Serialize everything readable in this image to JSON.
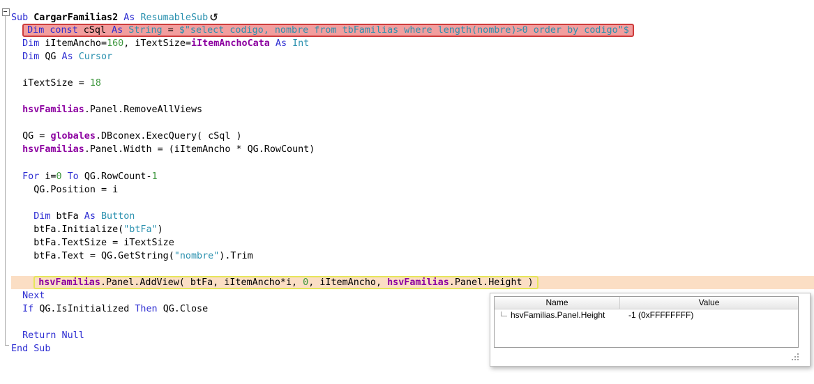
{
  "editor": {
    "colors": {
      "keyword": "#2d2dd2",
      "type": "#2b91af",
      "string": "#2b91af",
      "number": "#3c963c",
      "global_variable": "#8c00a0",
      "plain": "#000000",
      "error_highlight_bg": "#f29e9e",
      "error_highlight_border": "#ce3c3c",
      "current_line_bg": "#fbdec4",
      "current_statement_border": "#e6e65a",
      "fold_guide": "#ababab"
    },
    "icons": {
      "resumable_sub": "↺",
      "fold_collapse": "minus-box",
      "tree_branch": "corner-line",
      "resize_grip": "dot-triangle"
    },
    "lines": [
      {
        "i": 0,
        "h": null,
        "t": [
          [
            "k",
            "Sub "
          ],
          [
            "b",
            "CargarFamilias2"
          ],
          [
            "k",
            " As "
          ],
          [
            "t",
            "ResumableSub"
          ],
          [
            "ic",
            "↺"
          ]
        ]
      },
      {
        "i": 1,
        "h": "error",
        "t": [
          [
            "k",
            "Dim const "
          ],
          [
            "p",
            "cSql"
          ],
          [
            "k",
            " As "
          ],
          [
            "t",
            "String"
          ],
          [
            "p",
            " = "
          ],
          [
            "s",
            "$\"select codigo, nombre from tbFamilias where length(nombre)>0 order by codigo\"$"
          ]
        ]
      },
      {
        "i": 1,
        "h": null,
        "t": [
          [
            "k",
            "Dim "
          ],
          [
            "p",
            "iItemAncho="
          ],
          [
            "n",
            "160"
          ],
          [
            "p",
            ", iTextSize="
          ],
          [
            "g",
            "iItemAnchoCata"
          ],
          [
            "k",
            " As "
          ],
          [
            "t",
            "Int"
          ]
        ]
      },
      {
        "i": 1,
        "h": null,
        "t": [
          [
            "k",
            "Dim "
          ],
          [
            "p",
            "QG"
          ],
          [
            "k",
            " As "
          ],
          [
            "t",
            "Cursor"
          ]
        ]
      },
      {
        "i": 1,
        "h": null,
        "t": []
      },
      {
        "i": 1,
        "h": null,
        "t": [
          [
            "p",
            "iTextSize = "
          ],
          [
            "n",
            "18"
          ]
        ]
      },
      {
        "i": 1,
        "h": null,
        "t": []
      },
      {
        "i": 1,
        "h": null,
        "t": [
          [
            "g",
            "hsvFamilias"
          ],
          [
            "p",
            ".Panel.RemoveAllViews"
          ]
        ]
      },
      {
        "i": 1,
        "h": null,
        "t": []
      },
      {
        "i": 1,
        "h": null,
        "t": [
          [
            "p",
            "QG = "
          ],
          [
            "g",
            "globales"
          ],
          [
            "p",
            ".DBconex.ExecQuery( cSql )"
          ]
        ]
      },
      {
        "i": 1,
        "h": null,
        "t": [
          [
            "g",
            "hsvFamilias"
          ],
          [
            "p",
            ".Panel.Width = (iItemAncho * QG.RowCount)"
          ]
        ]
      },
      {
        "i": 1,
        "h": null,
        "t": []
      },
      {
        "i": 1,
        "h": null,
        "t": [
          [
            "k",
            "For "
          ],
          [
            "p",
            "i="
          ],
          [
            "n",
            "0"
          ],
          [
            "k",
            " To "
          ],
          [
            "p",
            "QG.RowCount-"
          ],
          [
            "n",
            "1"
          ]
        ]
      },
      {
        "i": 2,
        "h": null,
        "t": [
          [
            "p",
            "QG.Position = i"
          ]
        ]
      },
      {
        "i": 2,
        "h": null,
        "t": []
      },
      {
        "i": 2,
        "h": null,
        "t": [
          [
            "k",
            "Dim "
          ],
          [
            "p",
            "btFa"
          ],
          [
            "k",
            " As "
          ],
          [
            "t",
            "Button"
          ]
        ]
      },
      {
        "i": 2,
        "h": null,
        "t": [
          [
            "p",
            "btFa.Initialize("
          ],
          [
            "s",
            "\"btFa\""
          ],
          [
            "p",
            ")"
          ]
        ]
      },
      {
        "i": 2,
        "h": null,
        "t": [
          [
            "p",
            "btFa.TextSize = iTextSize"
          ]
        ]
      },
      {
        "i": 2,
        "h": null,
        "t": [
          [
            "p",
            "btFa.Text = QG.GetString("
          ],
          [
            "s",
            "\"nombre\""
          ],
          [
            "p",
            ").Trim"
          ]
        ]
      },
      {
        "i": 2,
        "h": null,
        "t": []
      },
      {
        "i": 2,
        "h": "current",
        "t": [
          [
            "g",
            "hsvFamilias"
          ],
          [
            "p",
            ".Panel.AddView( btFa, iItemAncho*i, "
          ],
          [
            "n",
            "0"
          ],
          [
            "p",
            ", iItemAncho, "
          ],
          [
            "g",
            "hsvFamilias"
          ],
          [
            "p",
            ".Panel.Height )"
          ]
        ]
      },
      {
        "i": 1,
        "h": null,
        "t": [
          [
            "k",
            "Next"
          ]
        ]
      },
      {
        "i": 1,
        "h": null,
        "t": [
          [
            "k",
            "If "
          ],
          [
            "p",
            "QG.IsInitialized"
          ],
          [
            "k",
            " Then "
          ],
          [
            "p",
            "QG.Close"
          ]
        ]
      },
      {
        "i": 1,
        "h": null,
        "t": []
      },
      {
        "i": 1,
        "h": null,
        "t": [
          [
            "k",
            "Return Null"
          ]
        ]
      },
      {
        "i": 0,
        "h": null,
        "t": [
          [
            "k",
            "End Sub"
          ]
        ]
      }
    ]
  },
  "watch_popup": {
    "columns": {
      "name": "Name",
      "value": "Value"
    },
    "rows": [
      {
        "name": "hsvFamilias.Panel.Height",
        "value": "-1 (0xFFFFFFFF)"
      }
    ]
  }
}
